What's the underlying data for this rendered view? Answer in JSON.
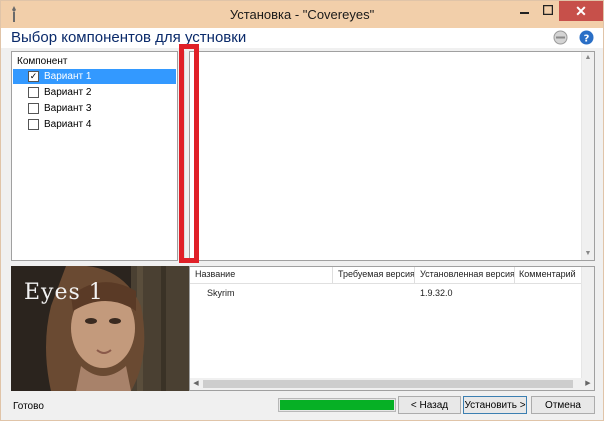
{
  "window": {
    "title": "Установка - \"Covereyes\"",
    "close_symbol": "✕"
  },
  "header": {
    "title": "Выбор компонентов для устновки"
  },
  "components": {
    "column_header": "Компонент",
    "items": [
      {
        "label": "Вариант 1",
        "checked": true,
        "selected": true
      },
      {
        "label": "Вариант 2",
        "checked": false,
        "selected": false
      },
      {
        "label": "Вариант 3",
        "checked": false,
        "selected": false
      },
      {
        "label": "Вариант 4",
        "checked": false,
        "selected": false
      }
    ]
  },
  "preview": {
    "caption": "Eyes 1"
  },
  "requirements": {
    "columns": [
      "Название",
      "Требуемая версия",
      "Установленная версия",
      "Комментарий"
    ],
    "rows": [
      {
        "name": "Skyrim",
        "required": "",
        "installed": "1.9.32.0",
        "comment": ""
      }
    ]
  },
  "status": {
    "text": "Готово",
    "progress": 1.0
  },
  "buttons": {
    "back": "< Назад",
    "install": "Установить >",
    "cancel": "Отмена"
  },
  "icons": {
    "app": "wrench-icon",
    "minimize": "minimize-icon",
    "maximize": "maximize-icon",
    "close": "close-icon",
    "settings": "settings-icon",
    "help": "help-icon"
  },
  "colors": {
    "titlebar": "#f2cfaa",
    "close_button": "#c7504a",
    "selection": "#3399ff",
    "progress": "#06b025",
    "marker": "#e02028"
  }
}
